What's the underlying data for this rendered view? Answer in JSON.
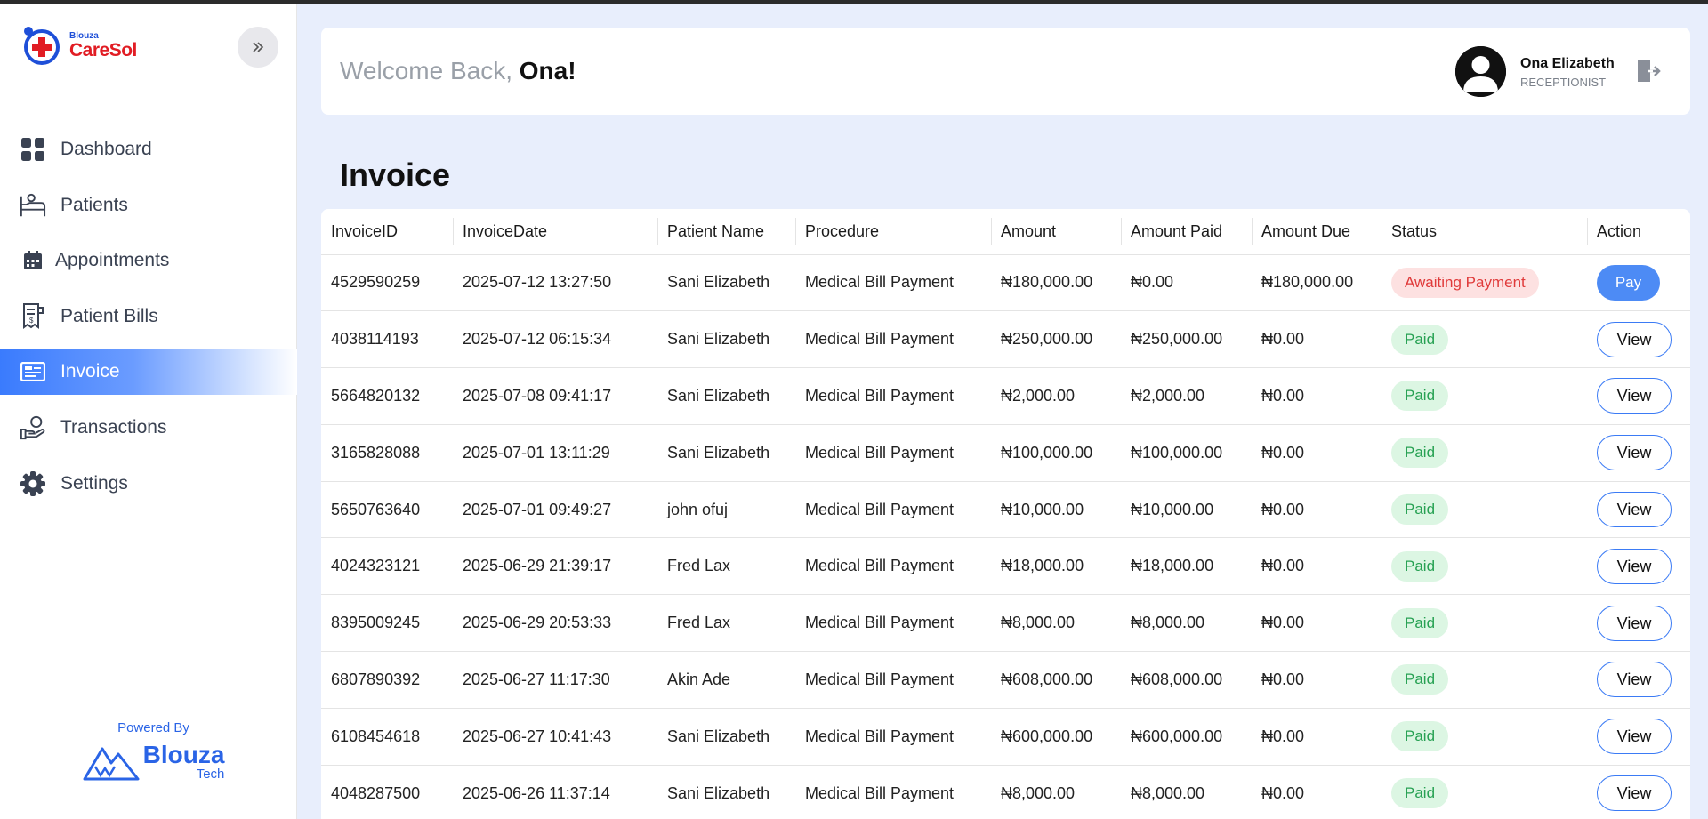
{
  "brand": {
    "small": "Blouza",
    "name": "CareSol"
  },
  "sidebar": {
    "items": [
      {
        "label": "Dashboard",
        "icon": "dashboard-icon"
      },
      {
        "label": "Patients",
        "icon": "patient-bed-icon"
      },
      {
        "label": "Appointments",
        "icon": "calendar-icon"
      },
      {
        "label": "Patient Bills",
        "icon": "receipt-icon"
      },
      {
        "label": "Invoice",
        "icon": "invoice-icon",
        "active": true
      },
      {
        "label": "Transactions",
        "icon": "hand-coin-icon"
      },
      {
        "label": "Settings",
        "icon": "gear-icon"
      }
    ],
    "powered_by": "Powered By",
    "footer_brand": {
      "name": "Blouza",
      "sub": "Tech"
    }
  },
  "header": {
    "welcome_prefix": "Welcome Back, ",
    "welcome_name": "Ona!",
    "user_name": "Ona Elizabeth",
    "user_role": "RECEPTIONIST"
  },
  "page": {
    "title": "Invoice"
  },
  "table": {
    "columns": [
      "InvoiceID",
      "InvoiceDate",
      "Patient Name",
      "Procedure",
      "Amount",
      "Amount Paid",
      "Amount Due",
      "Status",
      "Action"
    ],
    "rows": [
      [
        "4529590259",
        "2025-07-12 13:27:50",
        "Sani Elizabeth",
        "Medical Bill Payment",
        "₦180,000.00",
        "₦0.00",
        "₦180,000.00",
        "Awaiting Payment",
        "Pay"
      ],
      [
        "4038114193",
        "2025-07-12 06:15:34",
        "Sani Elizabeth",
        "Medical Bill Payment",
        "₦250,000.00",
        "₦250,000.00",
        "₦0.00",
        "Paid",
        "View"
      ],
      [
        "5664820132",
        "2025-07-08 09:41:17",
        "Sani Elizabeth",
        "Medical Bill Payment",
        "₦2,000.00",
        "₦2,000.00",
        "₦0.00",
        "Paid",
        "View"
      ],
      [
        "3165828088",
        "2025-07-01 13:11:29",
        "Sani Elizabeth",
        "Medical Bill Payment",
        "₦100,000.00",
        "₦100,000.00",
        "₦0.00",
        "Paid",
        "View"
      ],
      [
        "5650763640",
        "2025-07-01 09:49:27",
        "john ofuj",
        "Medical Bill Payment",
        "₦10,000.00",
        "₦10,000.00",
        "₦0.00",
        "Paid",
        "View"
      ],
      [
        "4024323121",
        "2025-06-29 21:39:17",
        "Fred Lax",
        "Medical Bill Payment",
        "₦18,000.00",
        "₦18,000.00",
        "₦0.00",
        "Paid",
        "View"
      ],
      [
        "8395009245",
        "2025-06-29 20:53:33",
        "Fred Lax",
        "Medical Bill Payment",
        "₦8,000.00",
        "₦8,000.00",
        "₦0.00",
        "Paid",
        "View"
      ],
      [
        "6807890392",
        "2025-06-27 11:17:30",
        "Akin Ade",
        "Medical Bill Payment",
        "₦608,000.00",
        "₦608,000.00",
        "₦0.00",
        "Paid",
        "View"
      ],
      [
        "6108454618",
        "2025-06-27 10:41:43",
        "Sani Elizabeth",
        "Medical Bill Payment",
        "₦600,000.00",
        "₦600,000.00",
        "₦0.00",
        "Paid",
        "View"
      ],
      [
        "4048287500",
        "2025-06-26 11:37:14",
        "Sani Elizabeth",
        "Medical Bill Payment",
        "₦8,000.00",
        "₦8,000.00",
        "₦0.00",
        "Paid",
        "View"
      ]
    ]
  },
  "colors": {
    "accent": "#3a7bfd",
    "awaiting": "#e03a3a",
    "paid": "#27a153",
    "background": "#e8eefc"
  }
}
